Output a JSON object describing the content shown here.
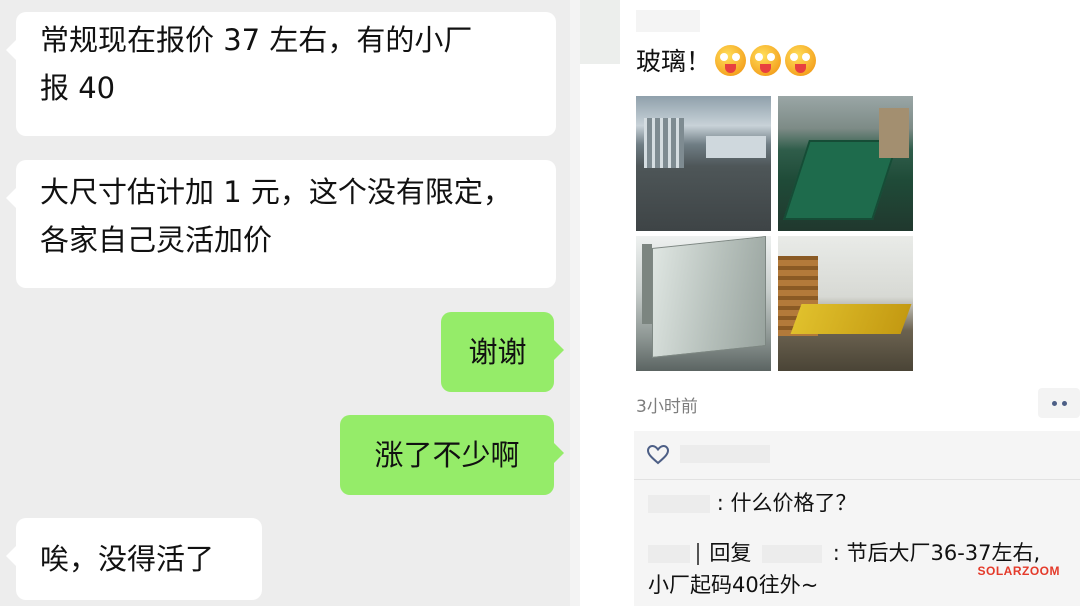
{
  "chat": {
    "messages": [
      {
        "side": "incoming",
        "lines": [
          "常规现在报价 37 左右，有的小厂",
          "报 40"
        ]
      },
      {
        "side": "incoming",
        "lines": [
          "大尺寸估计加 1 元，这个没有限定，",
          "各家自己灵活加价"
        ]
      },
      {
        "side": "outgoing",
        "lines": [
          "谢谢"
        ]
      },
      {
        "side": "outgoing",
        "lines": [
          "涨了不少啊"
        ]
      },
      {
        "side": "incoming",
        "lines": [
          "唉，没得活了"
        ]
      }
    ],
    "colors": {
      "background": "#ededed",
      "incoming_bubble": "#ffffff",
      "outgoing_bubble": "#95ec69"
    }
  },
  "post": {
    "text": "玻璃！",
    "emojis": [
      "tongue-out-face-icon",
      "tongue-out-face-icon",
      "tongue-out-face-icon"
    ],
    "photos": [
      "factory-floor-photo",
      "green-conveyor-photo",
      "glass-panel-stack-photo",
      "glass-loading-line-photo"
    ],
    "time": "3小时前",
    "comments": {
      "like_icon": "heart-outline-icon",
      "items": [
        {
          "text": ": 什么价格了？"
        },
        {
          "reply_word": "回复",
          "text_line1": ": 节后大厂36-37左右,",
          "text_line2": "小厂起码40往外~"
        }
      ]
    },
    "watermark": "SOLARZOOM"
  }
}
